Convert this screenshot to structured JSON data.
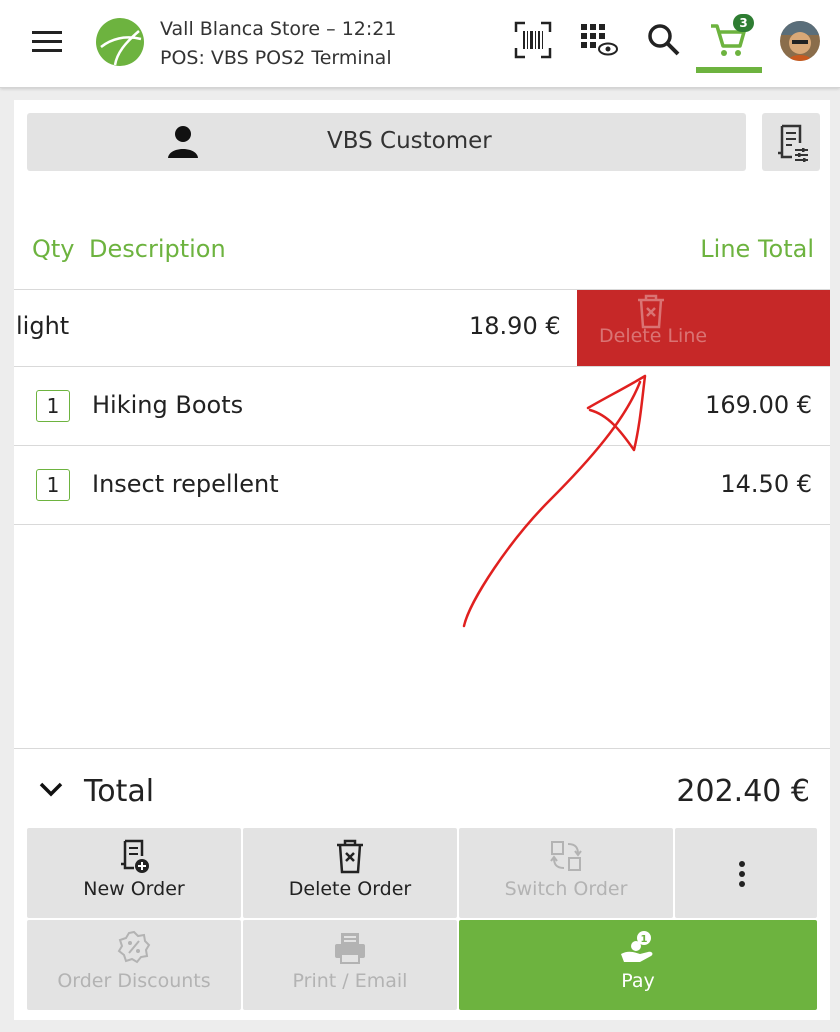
{
  "header": {
    "store_line": "Vall Blanca Store – 12:21",
    "terminal_line": "POS: VBS POS2 Terminal",
    "cart_count": "3",
    "icons": [
      "menu-icon",
      "store-logo",
      "barcode-scan-icon",
      "keypad-view-icon",
      "search-icon",
      "cart-icon",
      "avatar"
    ]
  },
  "customer": {
    "label": "VBS Customer"
  },
  "columns": {
    "qty": "Qty",
    "description": "Description",
    "line_total": "Line Total"
  },
  "lines": [
    {
      "name": "light",
      "total": "18.90 €",
      "swiped": true
    },
    {
      "qty": "1",
      "name": "Hiking Boots",
      "total": "169.00 €"
    },
    {
      "qty": "1",
      "name": "Insect repellent",
      "total": "14.50 €"
    }
  ],
  "swipe_action": {
    "label": "Delete Line"
  },
  "total": {
    "label": "Total",
    "value": "202.40 €"
  },
  "actions": {
    "new_order": "New Order",
    "delete_order": "Delete Order",
    "switch_order": "Switch Order",
    "order_discounts": "Order Discounts",
    "print_email": "Print / Email",
    "pay": "Pay"
  },
  "colors": {
    "accent": "#6db33f",
    "danger": "#c62828",
    "badge": "#2e7d32"
  }
}
